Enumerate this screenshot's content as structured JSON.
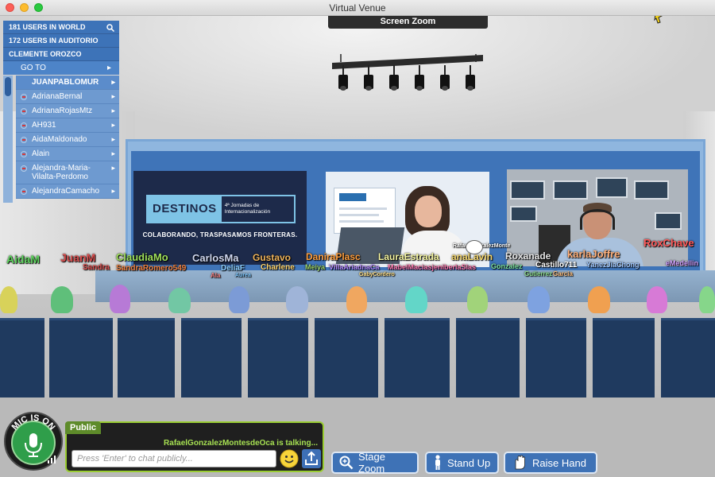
{
  "window": {
    "title": "Virtual Venue"
  },
  "top_bar": {
    "screen_zoom_label": "Screen Zoom"
  },
  "user_panel": {
    "world_count": "181 USERS IN WORLD",
    "auditorium_count": "172 USERS IN AUDITORIO",
    "current_user": "CLEMENTE OROZCO",
    "goto_label": "GO TO",
    "users": [
      {
        "name": "JUANPABLOMUR",
        "active": true
      },
      {
        "name": "AdrianaBernal"
      },
      {
        "name": "AdrianaRojasMtz"
      },
      {
        "name": "AH931"
      },
      {
        "name": "AidaMaldonado"
      },
      {
        "name": "Alain"
      },
      {
        "name": "Alejandra-Maria-Vilalta-Perdomo"
      },
      {
        "name": "AlejandraCamacho"
      }
    ]
  },
  "stage": {
    "left_screen": {
      "brand": "DESTINOS",
      "event_subtitle": "4ª Jornadas de Internacionalización",
      "tagline": "COLABORANDO, TRASPASAMOS FRONTERAS."
    }
  },
  "floating_names": [
    {
      "text": "AidaM",
      "color": "#5fd45f"
    },
    {
      "text": "JuanM",
      "color": "#d94d4d"
    },
    {
      "text": "ClaudiaMo",
      "color": "#9fe05a"
    },
    {
      "text": "CarlosMa",
      "color": "#cfd7f0"
    },
    {
      "text": "Gustavo",
      "color": "#f0b45a"
    },
    {
      "text": "DaniraPlasc",
      "color": "#ff9e3d"
    },
    {
      "text": "LauraEstrada",
      "color": "#f5f5a0"
    },
    {
      "text": "anaLavin",
      "color": "#f5d76e"
    },
    {
      "text": "Roxanade",
      "color": "#e6e6e6"
    },
    {
      "text": "karlaJoffre",
      "color": "#ffb07a"
    },
    {
      "text": "RoxChave",
      "color": "#ff5a5a"
    },
    {
      "text": "RafaelGonzalezMonte",
      "color": "#ffffff"
    },
    {
      "text": "Sandra",
      "color": "#d94d4d"
    },
    {
      "text": "SandraRomero549",
      "color": "#f08040"
    },
    {
      "text": "DeliaF",
      "color": "#8fd0ff"
    },
    {
      "text": "Charlene",
      "color": "#ffd36e"
    },
    {
      "text": "Meiya",
      "color": "#9fd66e"
    },
    {
      "text": "VillaAriadnaCa",
      "color": "#b58cff"
    },
    {
      "text": "MabelMaciasjeniberlaSlas",
      "color": "#ff7ab0"
    },
    {
      "text": "Gonzalez",
      "color": "#7ee0a0"
    },
    {
      "text": "Castillo711",
      "color": "#ffffff"
    },
    {
      "text": "YanezJiaChong",
      "color": "#a0c8ff"
    },
    {
      "text": "eMedellin",
      "color": "#d0a0ff"
    },
    {
      "text": "GabyCordero",
      "color": "#ffe08a"
    },
    {
      "text": "Ala",
      "color": "#f08080"
    },
    {
      "text": "Aurea",
      "color": "#7ec8ff"
    },
    {
      "text": "Garcia",
      "color": "#ffc080"
    },
    {
      "text": "Gutierrez",
      "color": "#90e090"
    }
  ],
  "chat": {
    "tab_label": "Public",
    "talking_status": "RafaelGonzalezMontesdeOca is talking...",
    "input_placeholder": "Press 'Enter' to chat publicly..."
  },
  "mic": {
    "status_label": "MIC IS ON"
  },
  "controls": {
    "stage_zoom_label": "Stage Zoom",
    "stand_up_label": "Stand Up",
    "raise_hand_label": "Raise Hand"
  },
  "colors": {
    "panel_blue": "#3d73b8",
    "chat_green": "#9acd32",
    "mic_green": "#2f9e4a",
    "talking_green": "#a6e052"
  }
}
